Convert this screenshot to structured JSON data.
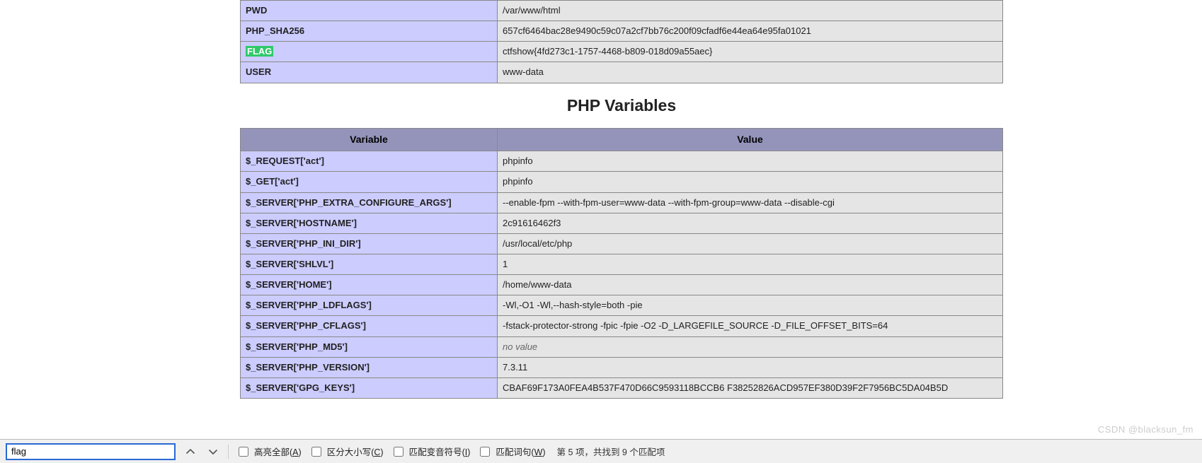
{
  "env_table": {
    "rows": [
      {
        "key": "PWD",
        "value": "/var/www/html"
      },
      {
        "key": "PHP_SHA256",
        "value": "657cf6464bac28e9490c59c07a2cf7bb76c200f09cfadf6e44ea64e95fa01021"
      },
      {
        "key": "FLAG",
        "value": "ctfshow{4fd273c1-1757-4468-b809-018d09a55aec}",
        "highlight_key": true
      },
      {
        "key": "USER",
        "value": "www-data"
      }
    ]
  },
  "section_title": "PHP Variables",
  "vars_table": {
    "headers": {
      "key": "Variable",
      "value": "Value"
    },
    "rows": [
      {
        "key": "$_REQUEST['act']",
        "value": "phpinfo"
      },
      {
        "key": "$_GET['act']",
        "value": "phpinfo"
      },
      {
        "key": "$_SERVER['PHP_EXTRA_CONFIGURE_ARGS']",
        "value": "--enable-fpm --with-fpm-user=www-data --with-fpm-group=www-data --disable-cgi"
      },
      {
        "key": "$_SERVER['HOSTNAME']",
        "value": "2c91616462f3"
      },
      {
        "key": "$_SERVER['PHP_INI_DIR']",
        "value": "/usr/local/etc/php"
      },
      {
        "key": "$_SERVER['SHLVL']",
        "value": "1"
      },
      {
        "key": "$_SERVER['HOME']",
        "value": "/home/www-data"
      },
      {
        "key": "$_SERVER['PHP_LDFLAGS']",
        "value": "-Wl,-O1 -Wl,--hash-style=both -pie"
      },
      {
        "key": "$_SERVER['PHP_CFLAGS']",
        "value": "-fstack-protector-strong -fpic -fpie -O2 -D_LARGEFILE_SOURCE -D_FILE_OFFSET_BITS=64"
      },
      {
        "key": "$_SERVER['PHP_MD5']",
        "value": "no value",
        "novalue": true
      },
      {
        "key": "$_SERVER['PHP_VERSION']",
        "value": "7.3.11"
      },
      {
        "key": "$_SERVER['GPG_KEYS']",
        "value": "CBAF69F173A0FEA4B537F470D66C9593118BCCB6 F38252826ACD957EF380D39F2F7956BC5DA04B5D"
      }
    ]
  },
  "findbar": {
    "search_value": "flag",
    "prev_icon": "˄",
    "next_icon": "˅",
    "highlight_all": {
      "label_pre": "高亮全部(",
      "key": "A",
      "label_post": ")"
    },
    "match_case": {
      "label_pre": "区分大小写(",
      "key": "C",
      "label_post": ")"
    },
    "match_diacritics": {
      "label_pre": "匹配变音符号(",
      "key": "I",
      "label_post": ")"
    },
    "whole_words": {
      "label_pre": "匹配词句(",
      "key": "W",
      "label_post": ")"
    },
    "status": "第 5 项，共找到 9 个匹配项"
  },
  "watermark": "CSDN @blacksun_fm"
}
